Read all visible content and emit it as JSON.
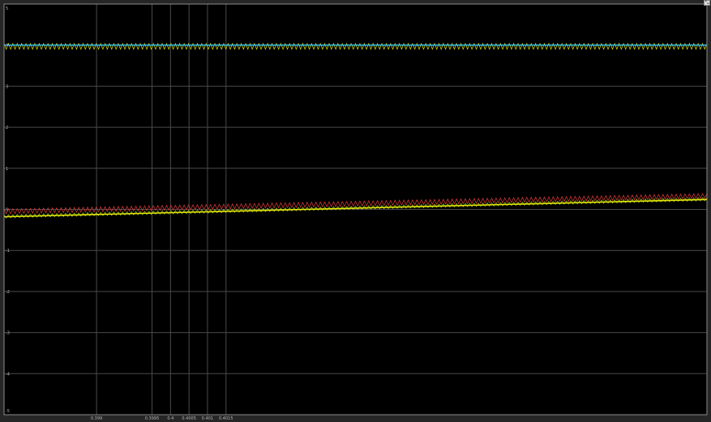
{
  "window": {
    "corner_button_glyph": "⤡"
  },
  "colors": {
    "background": "#000000",
    "frame": "#262626",
    "grid": "#4a4a4a",
    "axis_border": "#8c8c8c",
    "tick_text": "#b4b4b4"
  },
  "chart_data": {
    "type": "line",
    "title": "",
    "xlabel": "",
    "ylabel": "",
    "grid": true,
    "legend": "none",
    "xlim": [
      0.39955,
      0.40145
    ],
    "ylim": [
      -5,
      5
    ],
    "x_ticks": [
      0.3998,
      0.39995,
      0.4,
      0.40005,
      0.4001,
      0.40015
    ],
    "x_tick_labels": [
      "0.399",
      "0.3995",
      "0.4",
      "0.4005",
      "0.401",
      "0.4015"
    ],
    "y_ticks": [
      5,
      4,
      3,
      2,
      1,
      0,
      -1,
      -2,
      -3,
      -4,
      -5
    ],
    "y_tick_labels": [
      "5",
      "4",
      "3",
      "2",
      "1",
      "0",
      "-1",
      "-2",
      "-3",
      "-4",
      "-5"
    ],
    "series": [
      {
        "color": "#e6e600",
        "kind": "ripple",
        "x": [
          0.39955,
          0.40145
        ],
        "y": [
          3.97,
          3.97
        ],
        "ripple_amplitude": 0.07,
        "ripple_cycles": 160
      },
      {
        "color": "#2fb7e6",
        "kind": "line",
        "x": [
          0.39955,
          0.40145
        ],
        "y": [
          4.0,
          4.0
        ]
      },
      {
        "color": "#e63b3b",
        "kind": "ripple",
        "x": [
          0.39955,
          0.40145
        ],
        "y": [
          -0.05,
          0.33
        ],
        "ripple_amplitude": 0.06,
        "ripple_cycles": 160
      },
      {
        "color": "#9ad126",
        "kind": "ripple",
        "x": [
          0.39955,
          0.40145
        ],
        "y": [
          -0.17,
          0.25
        ],
        "ripple_amplitude": 0.04,
        "ripple_cycles": 160
      },
      {
        "color": "#e6e600",
        "kind": "line",
        "x": [
          0.39955,
          0.40145
        ],
        "y": [
          -0.18,
          0.24
        ]
      }
    ]
  }
}
